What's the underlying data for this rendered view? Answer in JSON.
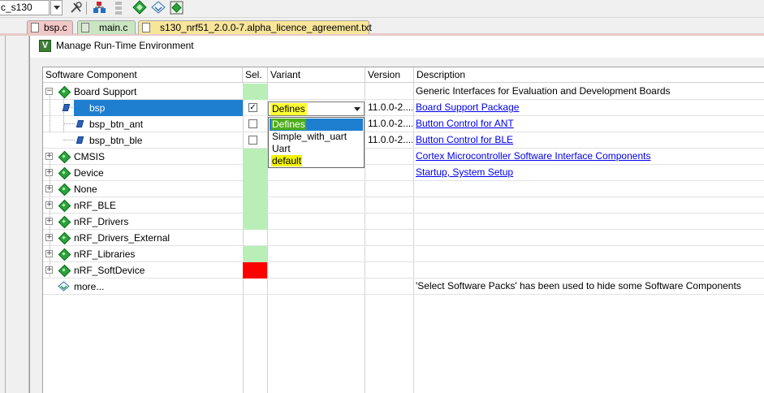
{
  "toolbar": {
    "target_text": "c_s130",
    "buttons": [
      {
        "name": "options-for-target-icon"
      },
      {
        "name": "manage-project-items-icon"
      },
      {
        "name": "select-packet-icon"
      },
      {
        "name": "manage-run-time-environment-icon"
      },
      {
        "name": "pack-installer-icon"
      },
      {
        "name": "manage-multi-project-icon"
      }
    ]
  },
  "tabs": [
    {
      "label": "bsp.c"
    },
    {
      "label": "main.c"
    },
    {
      "label": "s130_nrf51_2.0.0-7.alpha_licence_agreement.txt"
    }
  ],
  "dialog": {
    "title": "Manage Run-Time Environment",
    "columns": {
      "component": "Software Component",
      "sel": "Sel.",
      "variant": "Variant",
      "version": "Version",
      "description": "Description"
    },
    "rows": [
      {
        "name": "Board Support",
        "description": "Generic Interfaces for Evaluation and Development Boards",
        "link": false
      },
      {
        "name": "bsp",
        "version": "11.0.0-2....",
        "description": "Board Support Package",
        "link": true
      },
      {
        "name": "bsp_btn_ant",
        "version": "11.0.0-2....",
        "description": "Button Control for ANT",
        "link": true
      },
      {
        "name": "bsp_btn_ble",
        "version": "11.0.0-2....",
        "description": "Button Control for BLE",
        "link": true
      },
      {
        "name": "CMSIS",
        "description": "Cortex Microcontroller Software Interface Components",
        "link": true
      },
      {
        "name": "Device",
        "description": "Startup, System Setup",
        "link": true
      },
      {
        "name": "None",
        "description": "",
        "link": false
      },
      {
        "name": "nRF_BLE",
        "description": "",
        "link": false
      },
      {
        "name": "nRF_Drivers",
        "description": "",
        "link": false
      },
      {
        "name": "nRF_Drivers_External",
        "description": "",
        "link": false
      },
      {
        "name": "nRF_Libraries",
        "description": "",
        "link": false
      },
      {
        "name": "nRF_SoftDevice",
        "description": "",
        "link": false
      },
      {
        "name": "more...",
        "description": "'Select Software Packs' has been used to hide some Software Components",
        "link": false
      }
    ],
    "bsp_checkbox": "✓",
    "variant_combo": {
      "selected": "Defines",
      "options": [
        "Defines",
        "Simple_with_uart",
        "Uart",
        "default"
      ]
    }
  },
  "colors": {
    "selection": "#1e7fd0",
    "sel_ok": "#b9efb7",
    "sel_error": "#ff0000",
    "highlight_yellow": "#f3f300",
    "highlight_green": "#4cae1a",
    "link": "#0000ee"
  }
}
